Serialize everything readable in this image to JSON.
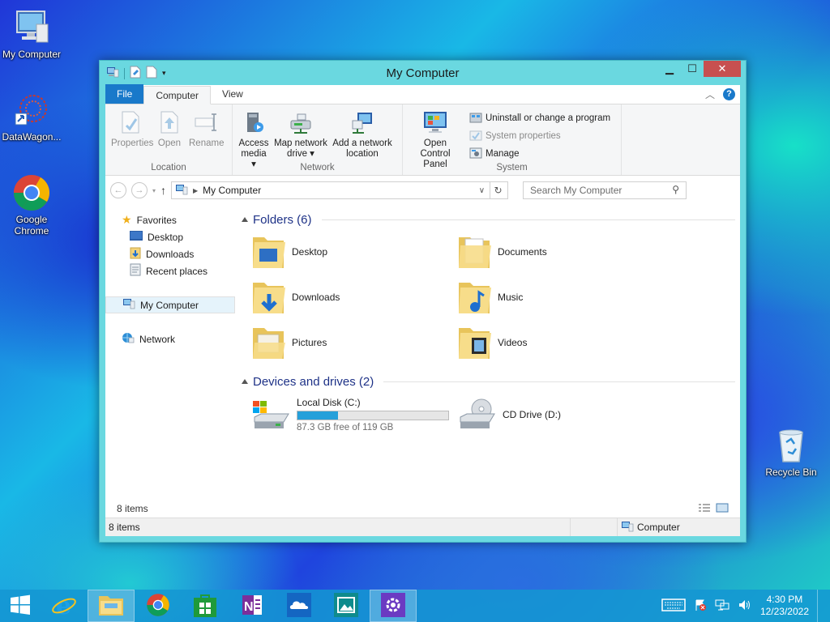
{
  "desktop": {
    "icons": [
      {
        "label": "My Computer"
      },
      {
        "label": "DataWagon..."
      },
      {
        "label": "Google Chrome"
      },
      {
        "label": "Recycle Bin"
      }
    ]
  },
  "window": {
    "title": "My Computer",
    "tabs": {
      "file": "File",
      "computer": "Computer",
      "view": "View"
    },
    "ribbon": {
      "location": {
        "label": "Location",
        "properties": "Properties",
        "open": "Open",
        "rename": "Rename"
      },
      "network": {
        "label": "Network",
        "access_media": "Access media",
        "map_drive": "Map network drive",
        "add_location": "Add a network location"
      },
      "system": {
        "label": "System",
        "open_cp": "Open Control Panel",
        "uninstall": "Uninstall or change a program",
        "sys_props": "System properties",
        "manage": "Manage"
      }
    },
    "address": {
      "path": "My Computer",
      "search_placeholder": "Search My Computer"
    },
    "nav": {
      "favorites": "Favorites",
      "desktop": "Desktop",
      "downloads": "Downloads",
      "recent": "Recent places",
      "my_computer": "My Computer",
      "network": "Network"
    },
    "folders": {
      "heading": "Folders (6)",
      "items": [
        "Desktop",
        "Documents",
        "Downloads",
        "Music",
        "Pictures",
        "Videos"
      ]
    },
    "drives": {
      "heading": "Devices and drives (2)",
      "local": {
        "name": "Local Disk (C:)",
        "free": "87.3 GB free of 119 GB",
        "used_fraction": 0.27
      },
      "cd": {
        "name": "CD Drive (D:)"
      }
    },
    "status_inner": "8 items",
    "status": {
      "count": "8 items",
      "location": "Computer"
    }
  },
  "taskbar": {
    "time": "4:30 PM",
    "date": "12/23/2022"
  }
}
